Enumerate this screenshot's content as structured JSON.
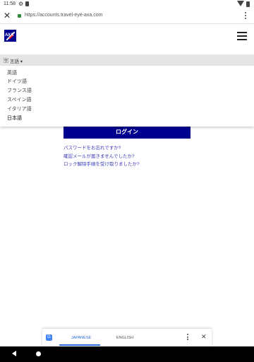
{
  "status_bar": {
    "time": "11:58"
  },
  "browser": {
    "url": "https://accounts.travel-eye-axa.com"
  },
  "header": {
    "logo_text": "AXA"
  },
  "language_selector": {
    "current_label": "言語",
    "options": [
      "英語",
      "ドイツ語",
      "フランス語",
      "スペイン語",
      "イタリア語",
      "日本語"
    ],
    "selected": "日本語"
  },
  "login": {
    "button_label": "ログイン"
  },
  "help_links": [
    "パスワードをお忘れですか?",
    "確認メールが届きませんでしたか?",
    "ロック解除手順を受け取りましたか?"
  ],
  "translate_bar": {
    "tab_japanese": "JAPANESE",
    "tab_english": "ENGLISH"
  }
}
